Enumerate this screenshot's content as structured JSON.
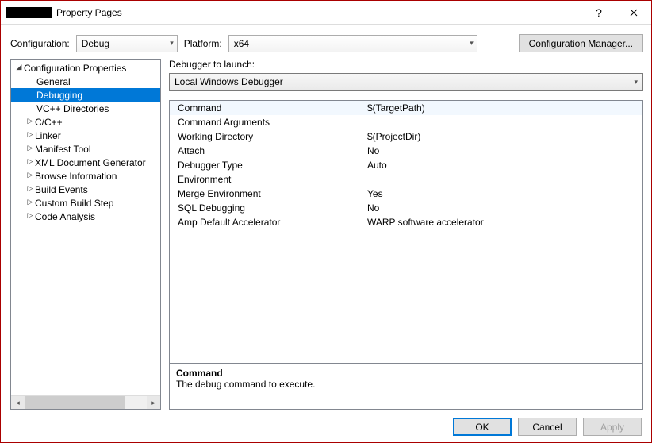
{
  "window": {
    "title": "Property Pages"
  },
  "toolbar": {
    "configuration_label": "Configuration:",
    "configuration_value": "Debug",
    "platform_label": "Platform:",
    "platform_value": "x64",
    "config_manager_label": "Configuration Manager..."
  },
  "tree": {
    "root": "Configuration Properties",
    "items": [
      {
        "label": "General",
        "expandable": false
      },
      {
        "label": "Debugging",
        "expandable": false,
        "selected": true
      },
      {
        "label": "VC++ Directories",
        "expandable": false
      },
      {
        "label": "C/C++",
        "expandable": true
      },
      {
        "label": "Linker",
        "expandable": true
      },
      {
        "label": "Manifest Tool",
        "expandable": true
      },
      {
        "label": "XML Document Generator",
        "expandable": true
      },
      {
        "label": "Browse Information",
        "expandable": true
      },
      {
        "label": "Build Events",
        "expandable": true
      },
      {
        "label": "Custom Build Step",
        "expandable": true
      },
      {
        "label": "Code Analysis",
        "expandable": true
      }
    ]
  },
  "debugger": {
    "label": "Debugger to launch:",
    "value": "Local Windows Debugger"
  },
  "properties": [
    {
      "name": "Command",
      "value": "$(TargetPath)",
      "selected": true
    },
    {
      "name": "Command Arguments",
      "value": ""
    },
    {
      "name": "Working Directory",
      "value": "$(ProjectDir)"
    },
    {
      "name": "Attach",
      "value": "No"
    },
    {
      "name": "Debugger Type",
      "value": "Auto"
    },
    {
      "name": "Environment",
      "value": ""
    },
    {
      "name": "Merge Environment",
      "value": "Yes"
    },
    {
      "name": "SQL Debugging",
      "value": "No"
    },
    {
      "name": "Amp Default Accelerator",
      "value": "WARP software accelerator"
    }
  ],
  "description": {
    "title": "Command",
    "text": "The debug command to execute."
  },
  "footer": {
    "ok": "OK",
    "cancel": "Cancel",
    "apply": "Apply"
  }
}
